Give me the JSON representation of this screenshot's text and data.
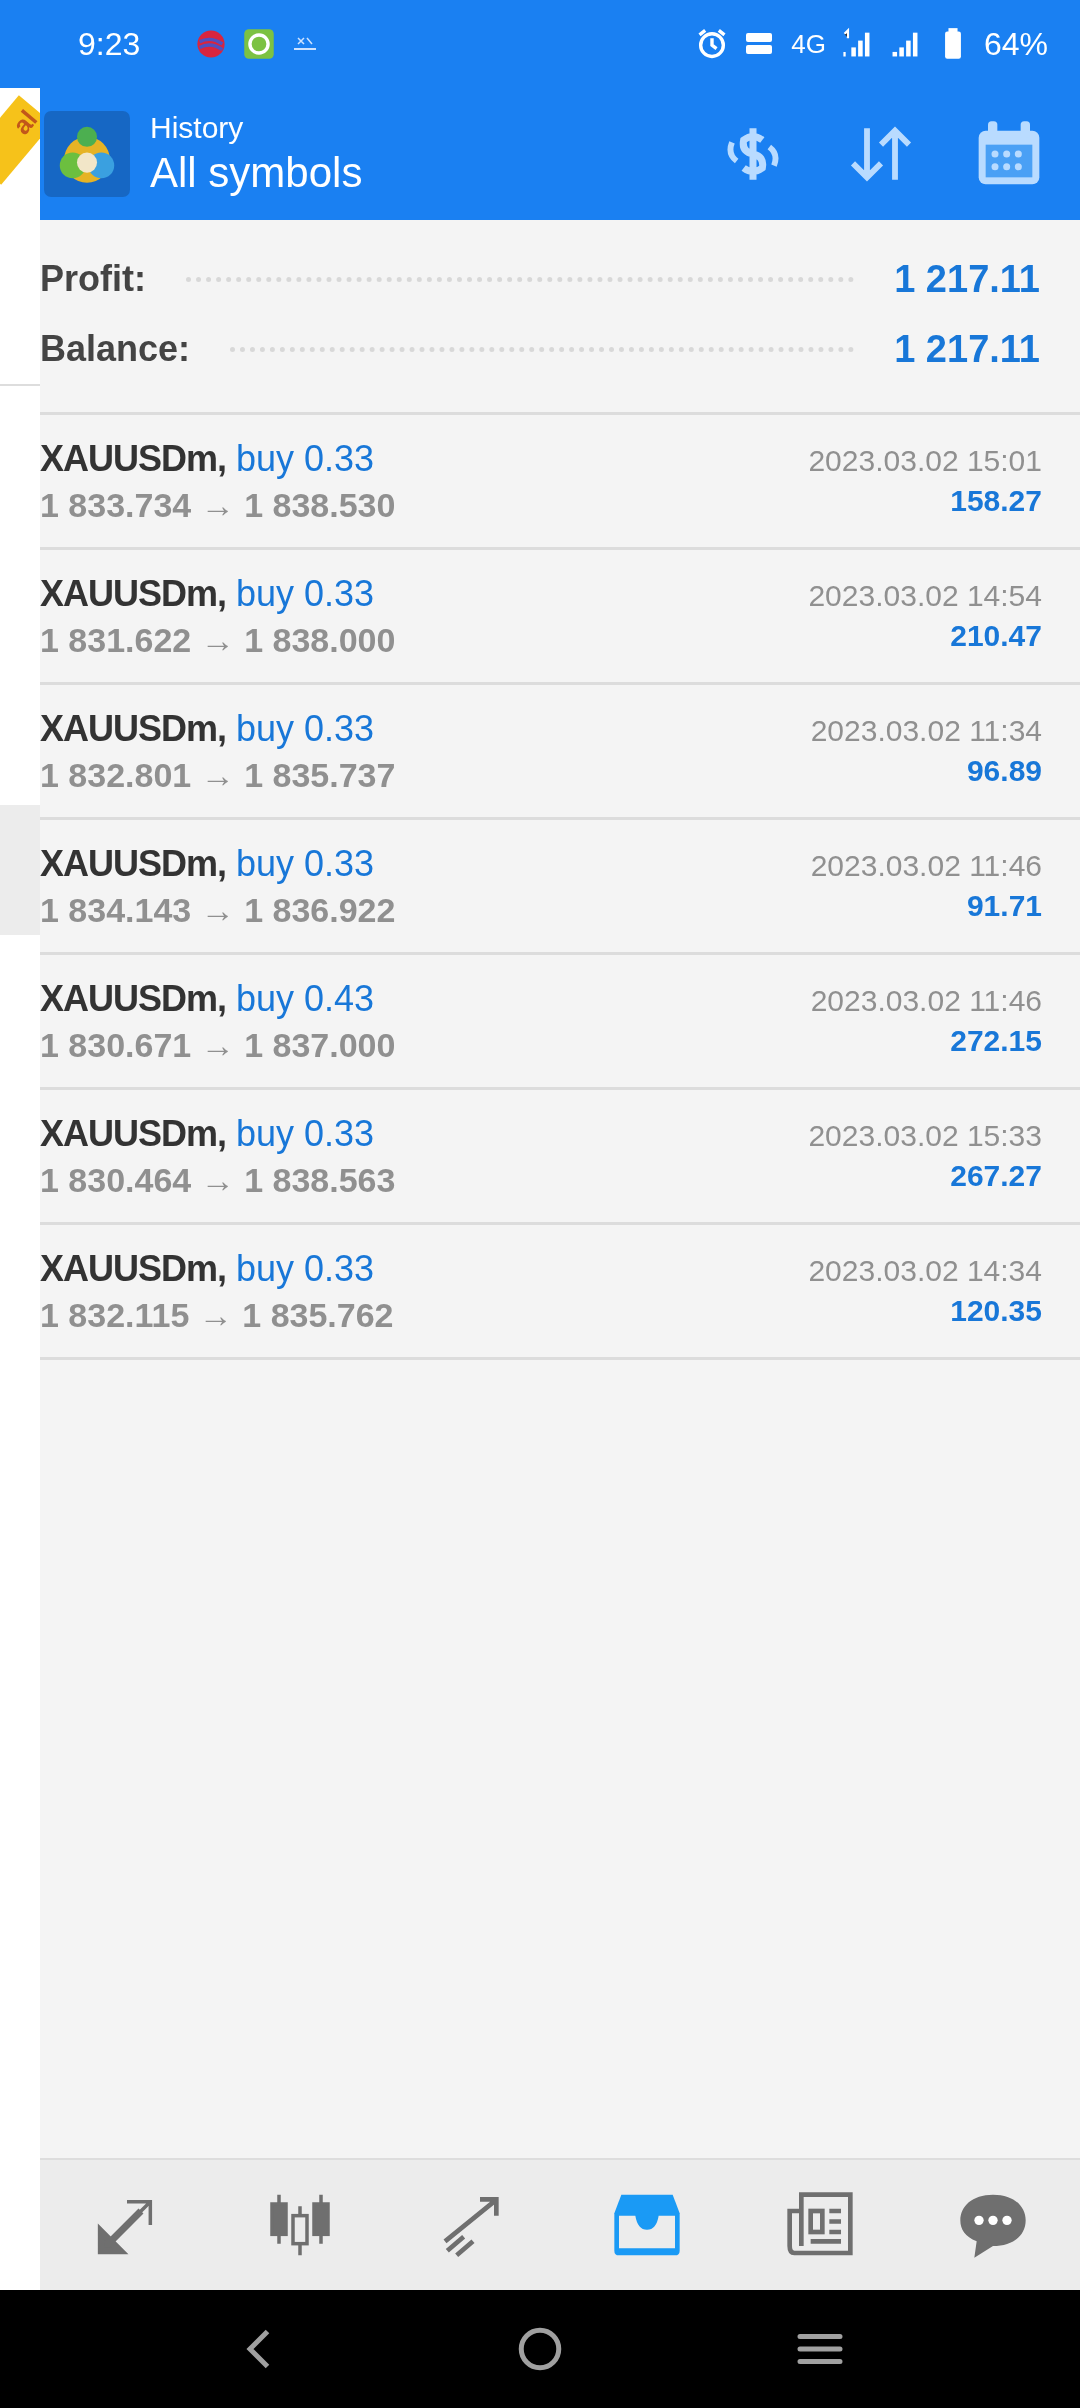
{
  "status_bar": {
    "time": "9:23",
    "network": "4G",
    "battery": "64%"
  },
  "account_ribbon": "al",
  "header": {
    "subtitle": "History",
    "title": "All symbols"
  },
  "summary": [
    {
      "label": "Profit:",
      "value": "1 217.11"
    },
    {
      "label": "Balance:",
      "value": "1 217.11"
    }
  ],
  "trades": [
    {
      "symbol": "XAUUSDm,",
      "side": "buy 0.33",
      "prices": "1 833.734 → 1 838.530",
      "time": "2023.03.02 15:01",
      "profit": "158.27"
    },
    {
      "symbol": "XAUUSDm,",
      "side": "buy 0.33",
      "prices": "1 831.622 → 1 838.000",
      "time": "2023.03.02 14:54",
      "profit": "210.47"
    },
    {
      "symbol": "XAUUSDm,",
      "side": "buy 0.33",
      "prices": "1 832.801 → 1 835.737",
      "time": "2023.03.02 11:34",
      "profit": "96.89"
    },
    {
      "symbol": "XAUUSDm,",
      "side": "buy 0.33",
      "prices": "1 834.143 → 1 836.922",
      "time": "2023.03.02 11:46",
      "profit": "91.71"
    },
    {
      "symbol": "XAUUSDm,",
      "side": "buy 0.43",
      "prices": "1 830.671 → 1 837.000",
      "time": "2023.03.02 11:46",
      "profit": "272.15"
    },
    {
      "symbol": "XAUUSDm,",
      "side": "buy 0.33",
      "prices": "1 830.464 → 1 838.563",
      "time": "2023.03.02 15:33",
      "profit": "267.27"
    },
    {
      "symbol": "XAUUSDm,",
      "side": "buy 0.33",
      "prices": "1 832.115 → 1 835.762",
      "time": "2023.03.02 14:34",
      "profit": "120.35"
    }
  ],
  "bottom_nav": [
    {
      "kind": "quotes",
      "selected": false
    },
    {
      "kind": "chart",
      "selected": false
    },
    {
      "kind": "trade",
      "selected": false
    },
    {
      "kind": "history",
      "selected": true
    },
    {
      "kind": "news",
      "selected": false
    },
    {
      "kind": "chat",
      "selected": false
    }
  ]
}
